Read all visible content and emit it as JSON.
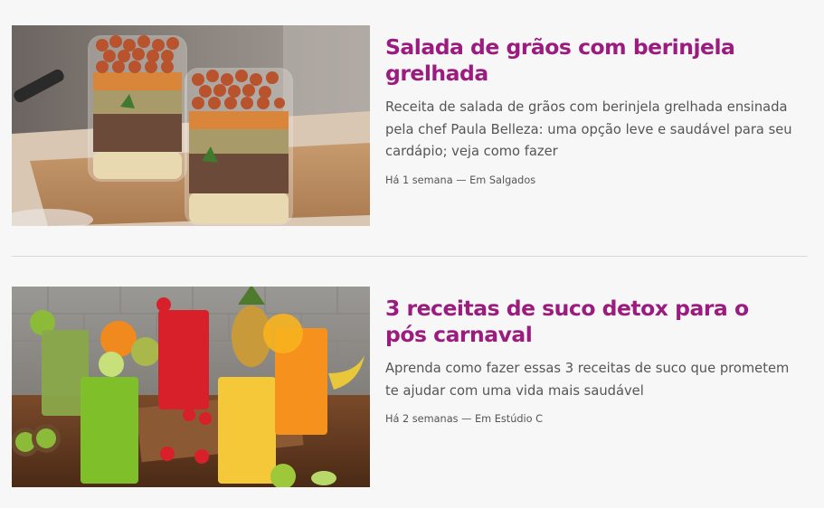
{
  "articles": [
    {
      "title": "Salada de grãos com berinjela grelhada",
      "description": "Receita de salada de grãos com berinjela grelhada ensinada pela chef Paula Belleza: uma opção leve e saudável para seu cardápio; veja como fazer",
      "time": "Há 1 semana",
      "separator": "—",
      "category": "Em Salgados"
    },
    {
      "title": "3 receitas de suco detox para o pós carnaval",
      "description": "Aprenda como fazer essas 3 receitas de suco que prometem te ajudar com uma vida mais saudável",
      "time": "Há 2 semanas",
      "separator": "—",
      "category": "Em Estúdio C"
    }
  ],
  "colors": {
    "title": "#9b1b7f",
    "text": "#555555",
    "background": "#f7f7f8",
    "divider": "#d9d9d9"
  }
}
